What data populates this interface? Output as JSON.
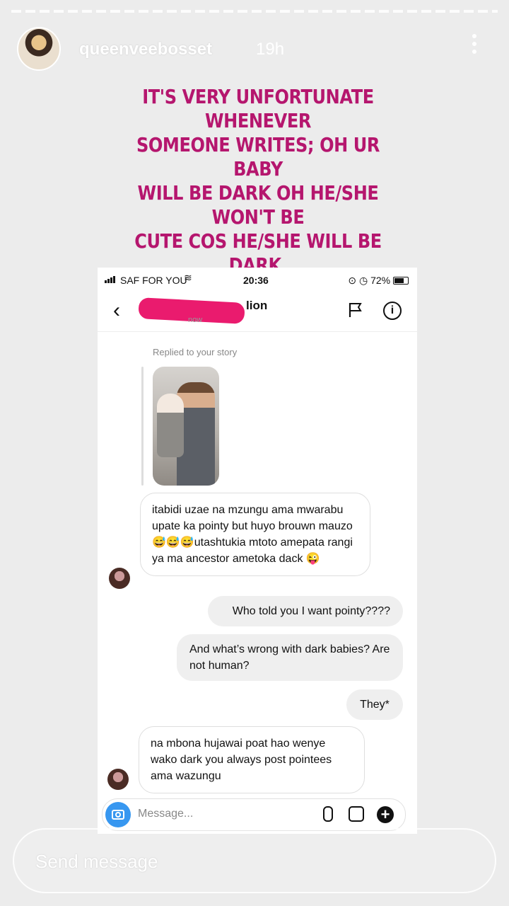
{
  "story": {
    "username": "queenveebosset",
    "time": "19h",
    "caption": "IT'S VERY UNFORTUNATE WHENEVER\nSOMEONE WRITES; OH UR BABY\nWILL BE DARK OH HE/SHE WON'T BE\nCUTE COS HE/SHE WILL BE DARK.\nWTF! 🤔😳 SO Y'ALL MEAN DARK\nBABIES AIN'T CUTE? IT GETS ME SICK\nTO MY DAMN STOMACH.",
    "colors": {
      "caption": "#b5166e",
      "redaction": "#ea1b6e",
      "camera_button": "#3797f0"
    }
  },
  "screenshot": {
    "status": {
      "carrier": "SAF FOR YOU",
      "time": "20:36",
      "battery": "72%"
    },
    "chat": {
      "name_tail": "lion",
      "active": "now",
      "replied_label": "Replied to your story",
      "messages": [
        {
          "from": "them",
          "text": "itabidi uzae na mzungu ama mwarabu upate ka pointy but huyo brouwn mauzo😅😅😅utashtukia mtoto amepata rangi ya ma ancestor ametoka dack 😜"
        },
        {
          "from": "me",
          "text": "Who told you I want pointy????"
        },
        {
          "from": "me",
          "text": "And what’s wrong with dark babies? Are not human?"
        },
        {
          "from": "me",
          "text": "They*"
        },
        {
          "from": "them",
          "text": "na mbona hujawai poat hao wenye wako dark you always post pointees ama  wazungu"
        }
      ],
      "composer_placeholder": "Message..."
    }
  },
  "send_message_placeholder": "Send message",
  "icons": [
    "more-icon",
    "back-icon",
    "flag-icon",
    "info-icon",
    "camera-icon",
    "mic-icon",
    "gallery-icon",
    "plus-icon"
  ]
}
